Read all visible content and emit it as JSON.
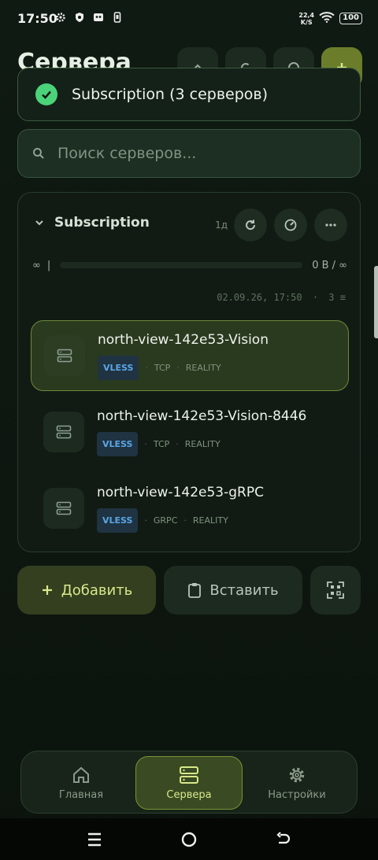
{
  "status_bar": {
    "time": "17:50",
    "net_speed_value": "22,4",
    "net_speed_unit": "K/S",
    "battery": "100"
  },
  "header": {
    "title": "Сервера"
  },
  "toast": {
    "text": "Subscription (3 серверов)"
  },
  "search": {
    "placeholder": "Поиск серверов..."
  },
  "subscription": {
    "title": "Subscription",
    "age": "1д",
    "traffic_left": "∞",
    "traffic_sep": "|",
    "traffic_right": "0 B / ∞",
    "progress": 0,
    "updated": "02.09.26, 17:50",
    "count": "3"
  },
  "servers": [
    {
      "name": "north-view-142e53-Vision",
      "protocol": "VLESS",
      "transport": "TCP",
      "security": "REALITY",
      "active": true
    },
    {
      "name": "north-view-142e53-Vision-8446",
      "protocol": "VLESS",
      "transport": "TCP",
      "security": "REALITY",
      "active": false
    },
    {
      "name": "north-view-142e53-gRPC",
      "protocol": "VLESS",
      "transport": "GRPC",
      "security": "REALITY",
      "active": false
    }
  ],
  "actions": {
    "add_label": "Добавить",
    "paste_label": "Вставить"
  },
  "nav": {
    "home": "Главная",
    "servers": "Сервера",
    "settings": "Настройки"
  },
  "colors": {
    "accent": "#d8e88b",
    "success": "#4bd37a",
    "protocol": "#5aa6e6"
  }
}
